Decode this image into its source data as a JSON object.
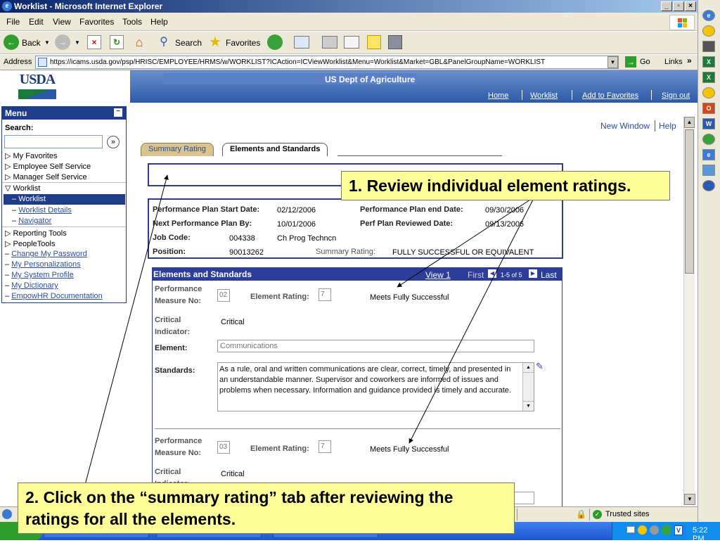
{
  "window": {
    "title": "Worklist - Microsoft Internet Explorer"
  },
  "menubar": [
    "File",
    "Edit",
    "View",
    "Favorites",
    "Tools",
    "Help"
  ],
  "toolbar": {
    "back": "Back",
    "search": "Search",
    "favorites": "Favorites"
  },
  "address": {
    "label": "Address",
    "url": "https://icams.usda.gov/psp/HRISC/EMPLOYEE/HRMS/w/WORKLIST?ICAction=ICViewWorklist&Menu=Worklist&Market=GBL&PanelGroupName=WORKLIST",
    "go": "Go",
    "links": "Links"
  },
  "header": {
    "logo": "USDA",
    "title": "US Dept of Agriculture",
    "links": [
      "Home",
      "Worklist",
      "Add to Favorites",
      "Sign out"
    ]
  },
  "menu": {
    "title": "Menu",
    "search_label": "Search:",
    "items": [
      "My Favorites",
      "Employee Self Service",
      "Manager Self Service",
      "Worklist"
    ],
    "worklist_sub": [
      "Worklist",
      "Worklist Details",
      "Navigator"
    ],
    "items2": [
      "Reporting Tools",
      "PeopleTools"
    ],
    "links": [
      "Change My Password",
      "My Personalizations",
      "My System Profile",
      "My Dictionary",
      "EmpowHR Documentation"
    ]
  },
  "page": {
    "new_window": "New Window",
    "help": "Help",
    "tabs": [
      "Summary Rating",
      "Elements and Standards"
    ],
    "info": {
      "start_label": "Performance Plan Start Date:",
      "start": "02/12/2006",
      "end_label": "Performance Plan end Date:",
      "end": "09/30/2006",
      "next_label": "Next Performance Plan By:",
      "next": "10/01/2006",
      "reviewed_label": "Perf Plan Reviewed Date:",
      "reviewed": "09/13/2006",
      "job_label": "Job Code:",
      "job": "004338",
      "job_desc": "Ch Prog Techncn",
      "pos_label": "Position:",
      "pos": "90013262",
      "summary_label": "Summary Rating:",
      "summary": "FULLY SUCCESSFUL OR EQUIVALENT"
    },
    "grid": {
      "title": "Elements and Standards",
      "view": "View 1",
      "first": "First",
      "range": "1-5 of 5",
      "last": "Last",
      "pm_label": "Performance Measure No:",
      "rating_label": "Element Rating:",
      "critical_label": "Critical Indicator:",
      "element_label": "Element:",
      "standards_label": "Standards:",
      "rows": [
        {
          "measure": "02",
          "rating": "7",
          "rating_text": "Meets Fully Successful",
          "critical": "Critical",
          "element": "Communications",
          "standards": "As a rule, oral and written communications are clear, correct, timely, and presented in an understandable manner. Supervisor and coworkers are informed of issues and problems when necessary. Information and guidance provided is timely and accurate."
        },
        {
          "measure": "03",
          "rating": "7",
          "rating_text": "Meets Fully Successful",
          "critical": "Critical"
        }
      ]
    }
  },
  "callouts": {
    "one": "1. Review individual element ratings.",
    "two": "2.  Click on the “summary rating” tab after reviewing the ratings for all the elements."
  },
  "status": {
    "trusted": "Trusted sites"
  },
  "taskbar": {
    "time": "5:22 PM"
  }
}
